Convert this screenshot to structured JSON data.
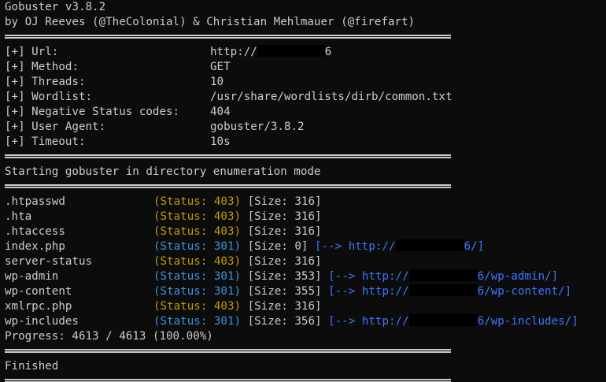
{
  "header": {
    "title": "Gobuster v3.8.2",
    "authors": "by OJ Reeves (@TheColonial) & Christian Mehlmauer (@firefart)"
  },
  "config": [
    {
      "key": "[+] Url:",
      "value_prefix": "http://",
      "value_suffix": "6",
      "redacted": true
    },
    {
      "key": "[+] Method:",
      "value": "GET"
    },
    {
      "key": "[+] Threads:",
      "value": "10"
    },
    {
      "key": "[+] Wordlist:",
      "value": "/usr/share/wordlists/dirb/common.txt"
    },
    {
      "key": "[+] Negative Status codes:",
      "value": "404"
    },
    {
      "key": "[+] User Agent:",
      "value": "gobuster/3.8.2"
    },
    {
      "key": "[+] Timeout:",
      "value": "10s"
    }
  ],
  "mode_line": "Starting gobuster in directory enumeration mode",
  "results": [
    {
      "path": ".htpasswd",
      "status": "(Status: 403)",
      "size": "[Size: 316]"
    },
    {
      "path": ".hta",
      "status": "(Status: 403)",
      "size": "[Size: 316]"
    },
    {
      "path": ".htaccess",
      "status": "(Status: 403)",
      "size": "[Size: 316]"
    },
    {
      "path": "index.php",
      "status": "(Status: 301)",
      "size": "[Size: 0]",
      "redirect_prefix": "[--> http://",
      "redirect_suffix": "6/]"
    },
    {
      "path": "server-status",
      "status": "(Status: 403)",
      "size": "[Size: 316]"
    },
    {
      "path": "wp-admin",
      "status": "(Status: 301)",
      "size": "[Size: 353]",
      "redirect_prefix": "[--> http://",
      "redirect_suffix": "6/wp-admin/]"
    },
    {
      "path": "wp-content",
      "status": "(Status: 301)",
      "size": "[Size: 355]",
      "redirect_prefix": "[--> http://",
      "redirect_suffix": "6/wp-content/]"
    },
    {
      "path": "xmlrpc.php",
      "status": "(Status: 403)",
      "size": "[Size: 316]"
    },
    {
      "path": "wp-includes",
      "status": "(Status: 301)",
      "size": "[Size: 356]",
      "redirect_prefix": "[--> http://",
      "redirect_suffix": "6/wp-includes/]"
    }
  ],
  "progress": "Progress: 4613 / 4613 (100.00%)",
  "finished": "Finished",
  "colors": {
    "background": "#0c0c0c",
    "foreground": "#cccccc",
    "status_403": "#c19c00",
    "status_301": "#3a96dd",
    "redirect": "#3b78ff"
  }
}
